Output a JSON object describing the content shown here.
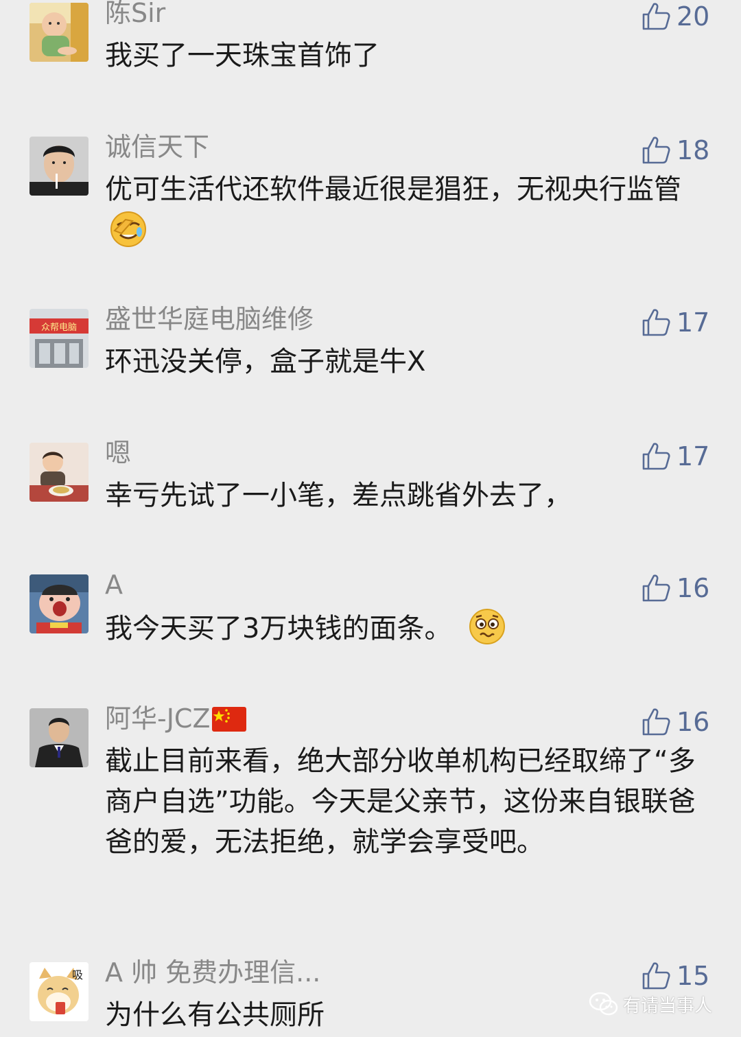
{
  "comments": [
    {
      "nickname": "陈Sir",
      "likes": "20",
      "text": "我买了一天珠宝首饰了",
      "avatar_icon": "baby-photo"
    },
    {
      "nickname": "诚信天下",
      "likes": "18",
      "text": "优可生活代还软件最近很是猖狂，无视央行监管",
      "emoji_icon": "facepalm-emoji",
      "avatar_icon": "man-with-cigarette-photo"
    },
    {
      "nickname": "盛世华庭电脑维修",
      "likes": "17",
      "text": "环迅没关停，盒子就是牛X",
      "avatar_icon": "storefront-photo",
      "avatar_sign": "众帮电脑"
    },
    {
      "nickname": "嗯",
      "likes": "17",
      "text": "幸亏先试了一小笔，差点跳省外去了，",
      "avatar_icon": "child-eating-photo"
    },
    {
      "nickname": "A",
      "likes": "16",
      "text": "我今天买了3万块钱的面条。",
      "emoji_icon": "worried-emoji",
      "avatar_icon": "cartoon-face-photo"
    },
    {
      "nickname": "阿华-JCZ",
      "likes": "16",
      "text": "截止目前来看，绝大部分收单机构已经取缔了“多商户自选”功能。今天是父亲节，这份来自银联爸爸的爱，无法拒绝，就学会享受吧。",
      "flag_icon": "china-flag-icon",
      "avatar_icon": "businessman-photo"
    },
    {
      "nickname": "A 帅 免费办理信...",
      "likes": "15",
      "text": "为什么有公共厕所",
      "avatar_icon": "shiba-dog-sticker",
      "avatar_sticker_text": "吸"
    }
  ],
  "watermark": {
    "text": "有请当事人",
    "icon": "wechat-icon"
  },
  "colors": {
    "background": "#ededed",
    "nickname": "#888888",
    "like": "#576b95",
    "text": "#1a1a1a"
  }
}
